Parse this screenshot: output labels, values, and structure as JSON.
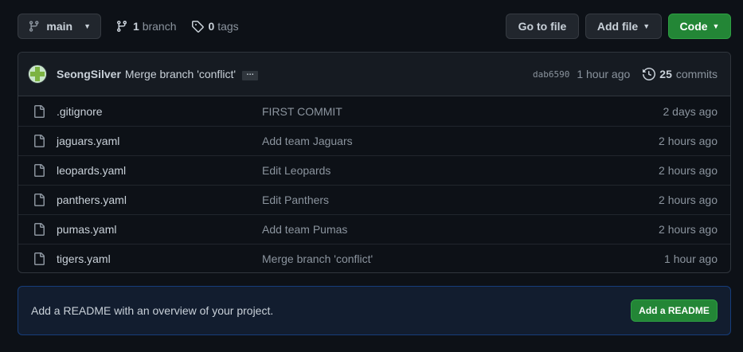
{
  "toolbar": {
    "branch_name": "main",
    "branch_count": "1",
    "branch_label": "branch",
    "tag_count": "0",
    "tag_label": "tags",
    "goto_file_label": "Go to file",
    "add_file_label": "Add file",
    "code_label": "Code"
  },
  "latest_commit": {
    "author": "SeongSilver",
    "message": "Merge branch 'conflict'",
    "ellipsis": "…",
    "sha": "dab6590",
    "time": "1 hour ago",
    "commit_count": "25",
    "commits_label": "commits"
  },
  "files": [
    {
      "name": ".gitignore",
      "message": "FIRST COMMIT",
      "time": "2 days ago"
    },
    {
      "name": "jaguars.yaml",
      "message": "Add team Jaguars",
      "time": "2 hours ago"
    },
    {
      "name": "leopards.yaml",
      "message": "Edit Leopards",
      "time": "2 hours ago"
    },
    {
      "name": "panthers.yaml",
      "message": "Edit Panthers",
      "time": "2 hours ago"
    },
    {
      "name": "pumas.yaml",
      "message": "Add team Pumas",
      "time": "2 hours ago"
    },
    {
      "name": "tigers.yaml",
      "message": "Merge branch 'conflict'",
      "time": "1 hour ago"
    }
  ],
  "readme": {
    "text": "Add a README with an overview of your project.",
    "button_label": "Add a README"
  },
  "colors": {
    "background": "#0d1117",
    "primary_button": "#238636",
    "readme_bg": "#121d2f"
  }
}
